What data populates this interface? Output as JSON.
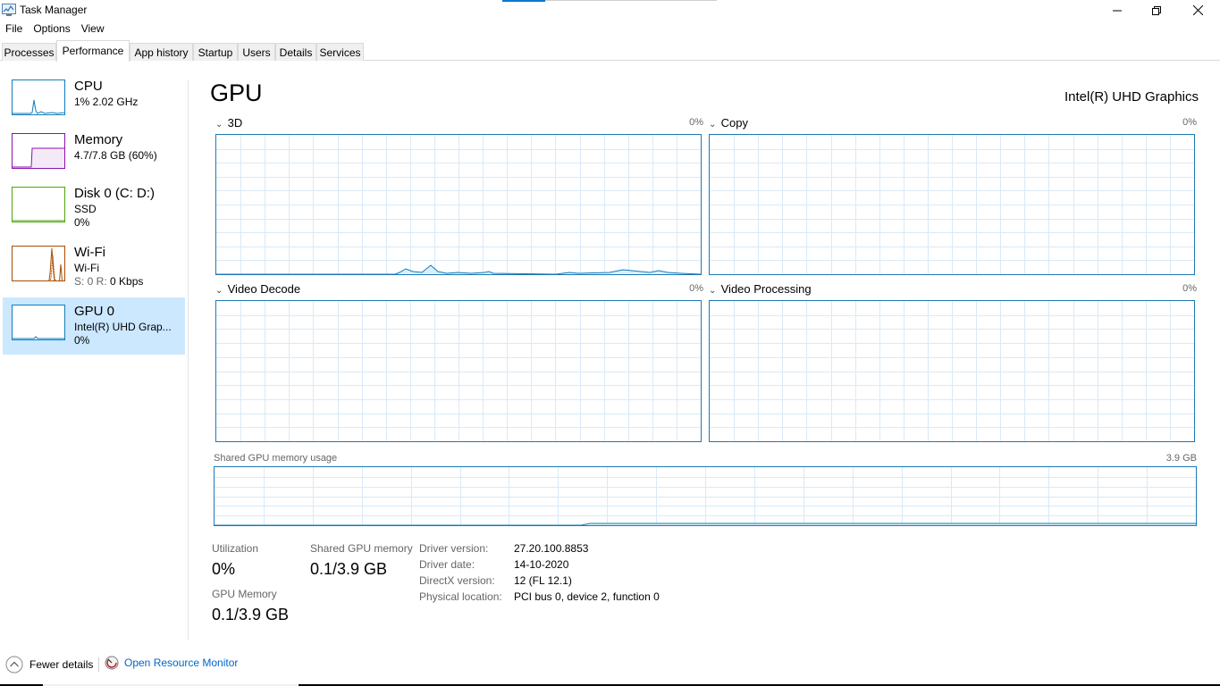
{
  "window": {
    "title": "Task Manager"
  },
  "menu": [
    "File",
    "Options",
    "View"
  ],
  "tabs": [
    {
      "label": "Processes"
    },
    {
      "label": "Performance"
    },
    {
      "label": "App history"
    },
    {
      "label": "Startup"
    },
    {
      "label": "Users"
    },
    {
      "label": "Details"
    },
    {
      "label": "Services"
    }
  ],
  "sidebar": {
    "items": [
      {
        "title": "CPU",
        "line1": "1%  2.02 GHz",
        "line2": "",
        "color": "#117dbb"
      },
      {
        "title": "Memory",
        "line1": "4.7/7.8 GB (60%)",
        "line2": "",
        "color": "#8b12ae"
      },
      {
        "title": "Disk 0 (C: D:)",
        "line1": "SSD",
        "line2": "0%",
        "color": "#4da60c"
      },
      {
        "title": "Wi-Fi",
        "line1": "Wi-Fi",
        "line2_prefix": "S: 0  R: ",
        "line2": "0 Kbps",
        "color": "#a74f01"
      },
      {
        "title": "GPU 0",
        "line1": "Intel(R) UHD Grap...",
        "line2": "0%",
        "color": "#117dbb"
      }
    ]
  },
  "main": {
    "title": "GPU",
    "device": "Intel(R) UHD Graphics",
    "graphs": [
      {
        "label": "3D",
        "pct": "0%"
      },
      {
        "label": "Copy",
        "pct": "0%"
      },
      {
        "label": "Video Decode",
        "pct": "0%"
      },
      {
        "label": "Video Processing",
        "pct": "0%"
      }
    ],
    "shared_mem": {
      "label": "Shared GPU memory usage",
      "max": "3.9 GB"
    },
    "stats": {
      "utilization_label": "Utilization",
      "utilization_value": "0%",
      "shared_label": "Shared GPU memory",
      "shared_value": "0.1/3.9 GB",
      "gpu_mem_label": "GPU Memory",
      "gpu_mem_value": "0.1/3.9 GB"
    },
    "info": [
      {
        "key": "Driver version:",
        "value": "27.20.100.8853"
      },
      {
        "key": "Driver date:",
        "value": "14-10-2020"
      },
      {
        "key": "DirectX version:",
        "value": "12 (FL 12.1)"
      },
      {
        "key": "Physical location:",
        "value": "PCI bus 0, device 2, function 0"
      }
    ]
  },
  "footer": {
    "fewer_details": "Fewer details",
    "resource_monitor": "Open Resource Monitor"
  },
  "colors": {
    "accent": "#0078d7",
    "graph_border": "#1f78b4",
    "grid": "#d9eaf7",
    "selected": "#cce8ff"
  }
}
